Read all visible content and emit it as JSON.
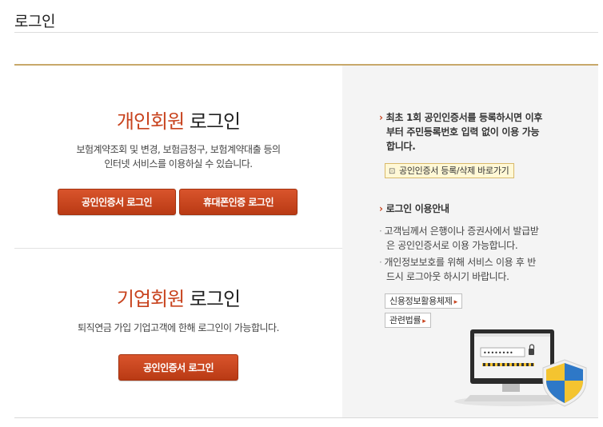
{
  "page": {
    "title": "로그인"
  },
  "personal": {
    "title_accent": "개인회원",
    "title_rest": "로그인",
    "desc_line1": "보험계약조회 및 변경, 보험금청구, 보험계약대출 등의",
    "desc_line2": "인터넷 서비스를 이용하실 수 있습니다.",
    "cert_login_label": "공인인증서 로그인",
    "phone_login_label": "휴대폰인증 로그인"
  },
  "corporate": {
    "title_accent": "기업회원",
    "title_rest": "로그인",
    "desc": "퇴직연금 가입 기업고객에 한해 로그인이 가능합니다.",
    "cert_login_label": "공인인증서 로그인"
  },
  "info": {
    "notice_line1": "최초 1회 공인인증서를 등록하시면 이후",
    "notice_line2": "부터 주민등록번호 입력 없이 이용 가능",
    "notice_line3": "합니다.",
    "cert_link_label": "공인인증서 등록/삭제 바로가기",
    "guide_title": "로그인 이용안내",
    "guide1_line1": "고객님께서 은행이나 증권사에서 발급받",
    "guide1_line2": "은 공인인증서로 이용 가능합니다.",
    "guide2_line1": "개인정보보호를 위해 서비스 이용 후 반",
    "guide2_line2": "드시 로그아웃 하시기 바랍니다.",
    "credit_info_btn": "신용정보활용체제",
    "law_btn": "관련법률",
    "password_mask": "••••••••",
    "accent_color": "#c8431e"
  }
}
